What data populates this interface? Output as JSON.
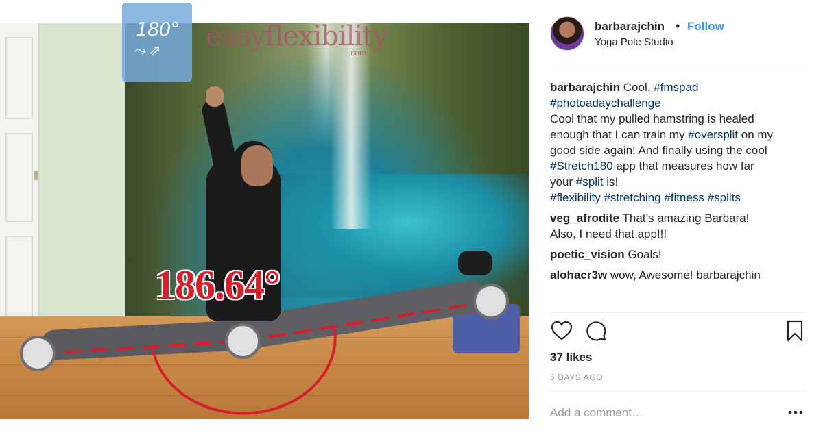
{
  "photo": {
    "angle_label": "186.64°",
    "logo_text": "180°",
    "brand_text": "easyflexibility",
    "brand_suffix": ".com"
  },
  "post": {
    "username": "barbarajchin",
    "separator": "•",
    "follow_label": "Follow",
    "location": "Yoga Pole Studio",
    "caption": {
      "author": "barbarajchin",
      "lines": [
        [
          {
            "t": "Cool. "
          },
          {
            "t": "#fmspad",
            "tag": true
          }
        ],
        [
          {
            "t": "#photoadaychallenge",
            "tag": true
          }
        ],
        [
          {
            "t": "Cool that my pulled hamstring is healed"
          }
        ],
        [
          {
            "t": "enough that I can train my "
          },
          {
            "t": "#oversplit",
            "tag": true
          },
          {
            "t": " on my"
          }
        ],
        [
          {
            "t": "good side again! And finally using the cool"
          }
        ],
        [
          {
            "t": "#Stretch180",
            "tag": true
          },
          {
            "t": " app that measures how far"
          }
        ],
        [
          {
            "t": "your "
          },
          {
            "t": "#split",
            "tag": true
          },
          {
            "t": " is!"
          }
        ],
        [
          {
            "t": "#flexibility",
            "tag": true
          },
          {
            "t": " "
          },
          {
            "t": "#stretching",
            "tag": true
          },
          {
            "t": " "
          },
          {
            "t": "#fitness",
            "tag": true
          },
          {
            "t": " "
          },
          {
            "t": "#splits",
            "tag": true
          }
        ]
      ]
    },
    "comments": [
      {
        "user": "veg_afrodite",
        "lines": [
          "That’s amazing Barbara!",
          "Also, I need that app!!!"
        ]
      },
      {
        "user": "poetic_vision",
        "lines": [
          "Goals!"
        ]
      },
      {
        "user": "alohacr3w",
        "lines": [
          "wow, Awesome! barbarajchin"
        ]
      }
    ],
    "likes": "37 likes",
    "date": "5 DAYS AGO",
    "add_comment_placeholder": "Add a comment…",
    "more_label": "•••"
  },
  "icons": [
    "heart-icon",
    "comment-icon",
    "bookmark-icon",
    "more-options-icon"
  ],
  "colors": {
    "follow": "#3897f0",
    "hashtag": "#003569",
    "angle": "#d61f2b",
    "muted": "#999999"
  }
}
